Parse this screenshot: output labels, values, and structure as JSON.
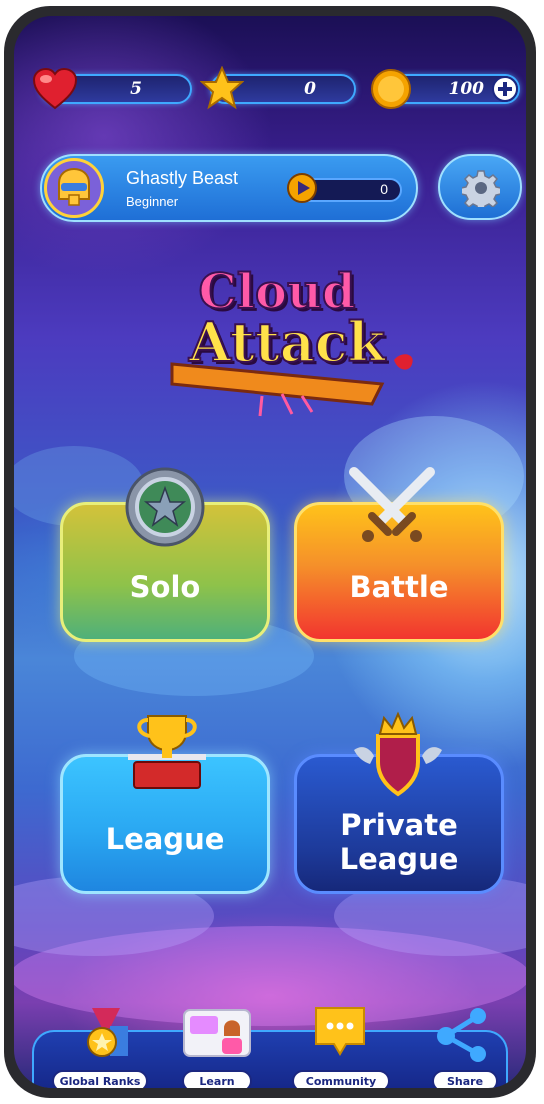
{
  "stats": {
    "lives": "5",
    "stars": "0",
    "coins": "100"
  },
  "profile": {
    "name": "Ghastly Beast",
    "rank": "Beginner",
    "xp": "0"
  },
  "logo": {
    "line1": "Cloud",
    "line2": "Attack"
  },
  "modes": {
    "solo": "Solo",
    "battle": "Battle",
    "league": "League",
    "private_league_1": "Private",
    "private_league_2": "League"
  },
  "nav": {
    "global_ranks": "Global Ranks",
    "learn": "Learn",
    "community": "Community",
    "share": "Share"
  },
  "colors": {
    "solo_card": "#8ec24a",
    "battle_card": "#f2552f",
    "league_card": "#2aa8f2",
    "private_league_card": "#1d3a9a",
    "accent": "#3fa9ff"
  }
}
